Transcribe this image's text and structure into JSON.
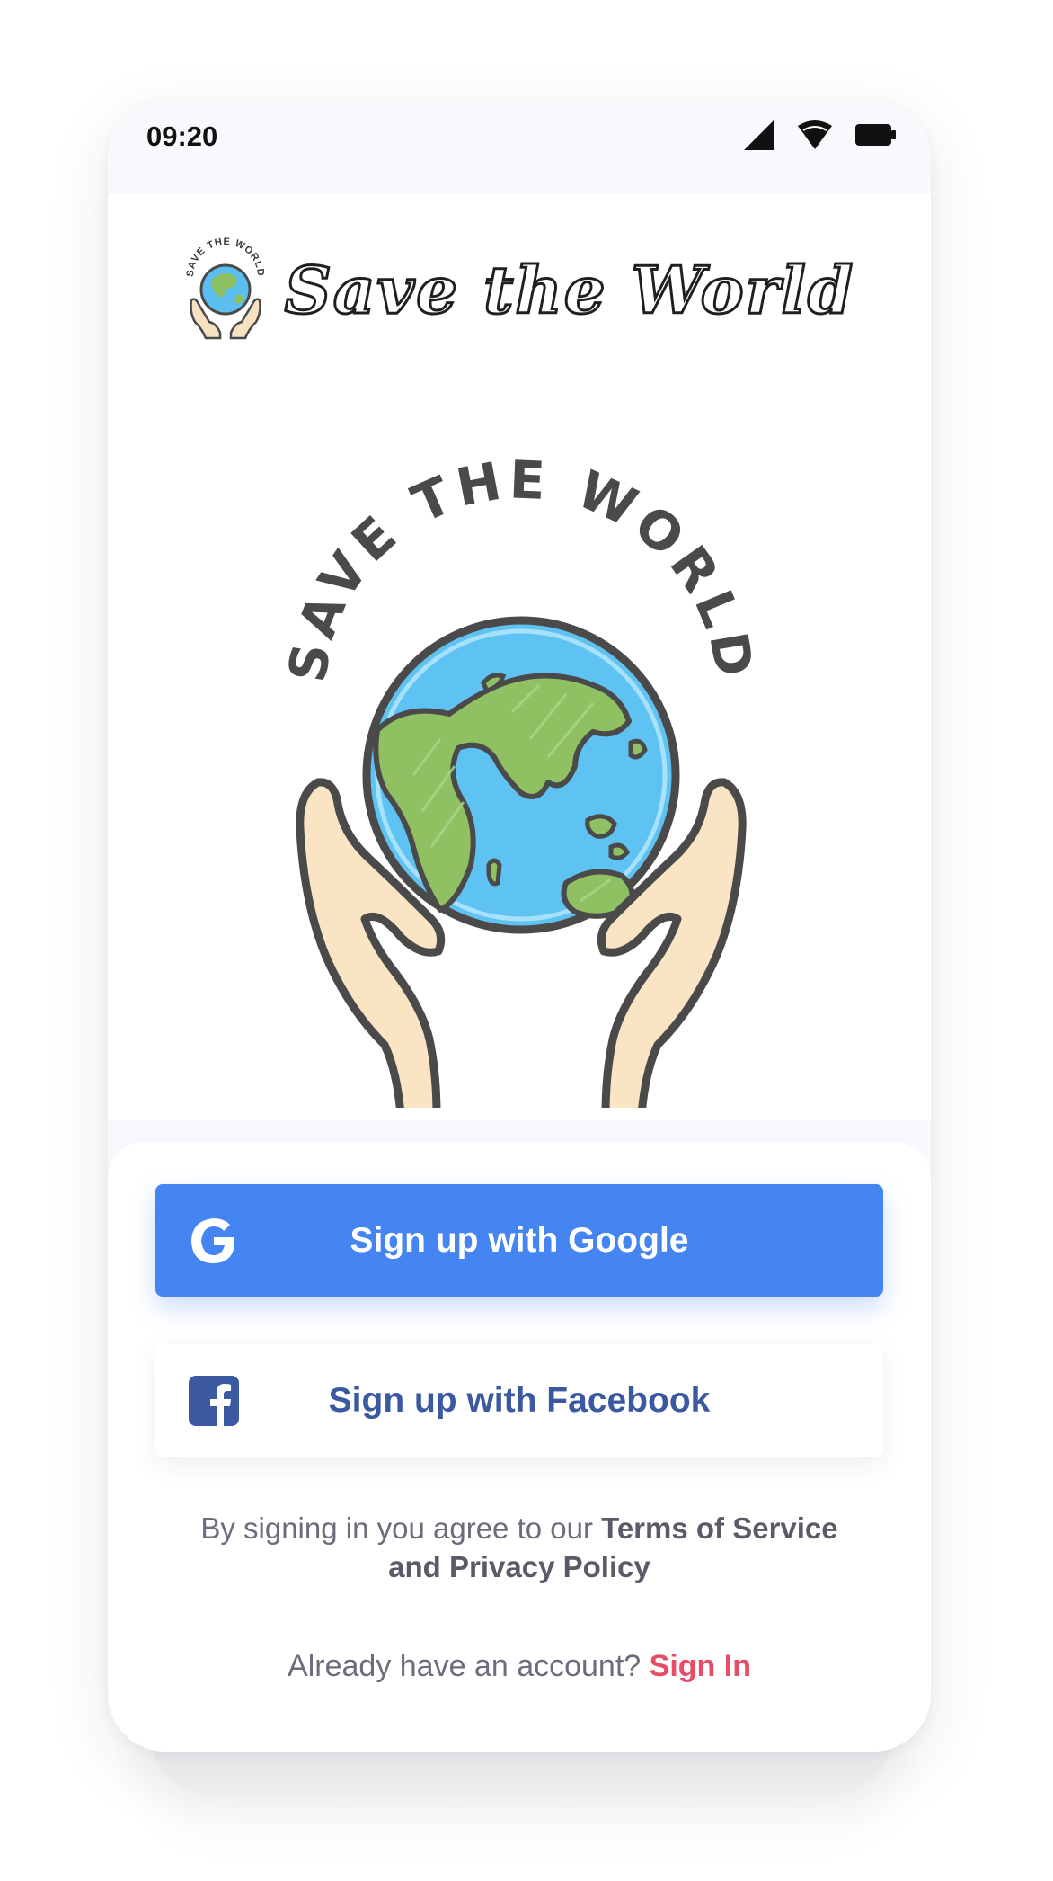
{
  "status_bar": {
    "time": "09:20",
    "icons": [
      "signal-icon",
      "wifi-icon",
      "battery-icon"
    ]
  },
  "header": {
    "logo_icon": "globe-in-hands-icon",
    "logo_text": "SAVE THE WORLD",
    "title": "Save the World"
  },
  "hero": {
    "illustration": "globe-in-hands-illustration",
    "arc_text": "SAVE THE WORLD"
  },
  "auth": {
    "google_label": "Sign up with Google",
    "google_icon": "google-icon",
    "facebook_label": "Sign up with Facebook",
    "facebook_icon": "facebook-icon",
    "terms_prefix": "By signing in you agree to our ",
    "terms_link": "Terms of Service and Privacy Policy",
    "account_prompt": "Already have an account? ",
    "signin_label": "Sign In"
  },
  "colors": {
    "google_blue": "#4485f2",
    "facebook_blue": "#3b59a0",
    "signin_red": "#e84d67",
    "text_gray": "#6d6b7c"
  }
}
